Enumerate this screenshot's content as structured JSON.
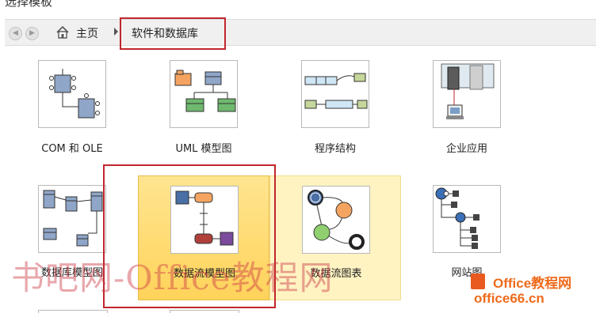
{
  "window": {
    "title": "选择模板"
  },
  "nav": {
    "back_icon": "back-arrow-icon",
    "forward_icon": "forward-arrow-icon",
    "home_icon": "home-icon",
    "home_label": "主页",
    "current_label": "软件和数据库"
  },
  "templates": [
    {
      "label": "COM 和 OLE",
      "icon": "com-ole-diagram-icon"
    },
    {
      "label": "UML 模型图",
      "icon": "uml-diagram-icon"
    },
    {
      "label": "程序结构",
      "icon": "program-structure-icon"
    },
    {
      "label": "企业应用",
      "icon": "enterprise-application-icon"
    },
    {
      "label": "数据库模型图",
      "icon": "database-model-icon"
    },
    {
      "label": "数据流模型图",
      "icon": "data-flow-model-icon",
      "state": "selected"
    },
    {
      "label": "数据流图表",
      "icon": "data-flow-diagram-icon",
      "state": "hover"
    },
    {
      "label": "网站图",
      "icon": "website-map-icon"
    }
  ],
  "watermark": {
    "text": "书吧网-Office教程网"
  },
  "logo": {
    "name": "Office教程网",
    "url": "office66.cn",
    "color": "#ee6b1d"
  },
  "colors": {
    "highlight": "#c0262d",
    "selected_tile": "#ffd35a",
    "hover_tile": "#fff3c2"
  }
}
